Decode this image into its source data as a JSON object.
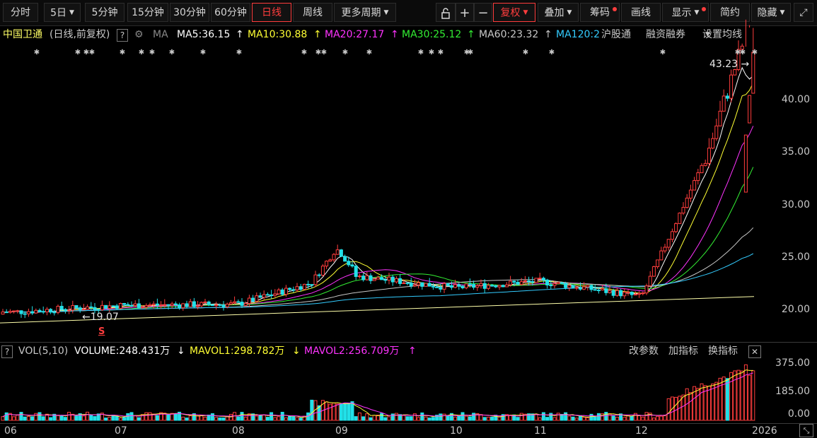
{
  "toolbar": {
    "items": [
      {
        "label": "分时"
      },
      {
        "label": "5日"
      },
      {
        "label": "5分钟"
      },
      {
        "label": "15分钟"
      },
      {
        "label": "30分钟"
      },
      {
        "label": "60分钟"
      },
      {
        "label": "日线"
      },
      {
        "label": "周线"
      },
      {
        "label": "更多周期"
      }
    ],
    "right_items": [
      {
        "label": "复权"
      },
      {
        "label": "叠加"
      },
      {
        "label": "筹码"
      },
      {
        "label": "画线"
      },
      {
        "label": "显示"
      },
      {
        "label": "简约"
      },
      {
        "label": "隐藏"
      }
    ],
    "plus": "+",
    "minus": "−",
    "expand": "⤢"
  },
  "stock": {
    "name": "中国卫通",
    "mode": "(日线,前复权)",
    "help": "?",
    "ma_title": "MA"
  },
  "ma_lines": [
    {
      "label": "MA5:36.15",
      "arrow": "↑",
      "color": "#ffffff"
    },
    {
      "label": "MA10:30.88",
      "arrow": "↑",
      "color": "#ffff33"
    },
    {
      "label": "MA20:27.17",
      "arrow": "↑",
      "color": "#ff33ff"
    },
    {
      "label": "MA30:25.12",
      "arrow": "↑",
      "color": "#33ee33"
    },
    {
      "label": "MA60:23.32",
      "arrow": "↑",
      "color": "#c8c8c8"
    },
    {
      "label": "MA120:2",
      "arrow": "",
      "color": "#33ccff"
    }
  ],
  "links": {
    "hgt": "沪股通",
    "rzrq": "融资融券",
    "setting": "设置均线"
  },
  "price_axis": {
    "labels": [
      "40.00",
      "35.00",
      "30.00",
      "25.00",
      "20.00"
    ]
  },
  "annotations": {
    "high": "43.23",
    "low": "19.07",
    "signal": "S"
  },
  "volume": {
    "title": "VOL(5,10)",
    "volume": "VOLUME:248.431万",
    "volume_arrow": "↓",
    "mavol1": "MAVOL1:298.782万",
    "mavol1_arrow": "↓",
    "mavol2": "MAVOL2:256.709万",
    "mavol2_arrow": "↑",
    "actions": [
      "改参数",
      "加指标",
      "换指标"
    ],
    "axis_labels": [
      "375.00",
      "185.00",
      "0.00"
    ]
  },
  "x_axis": {
    "labels": [
      "06",
      "07",
      "08",
      "09",
      "10",
      "11",
      "12",
      "2026"
    ]
  },
  "colors": {
    "up": "#ff3d3d",
    "down": "#22e0e8",
    "bg": "#000000"
  },
  "chart_data": {
    "type": "candlestick",
    "price_range": [
      17,
      44
    ],
    "volume_range": [
      0,
      400
    ],
    "key_points": [
      {
        "x": "06",
        "close": 19.6
      },
      {
        "x": "07",
        "close": 20.2
      },
      {
        "x": "08",
        "close": 20.3
      },
      {
        "x": "09",
        "close": 23.0
      },
      {
        "x": "10",
        "close": 21.8
      },
      {
        "x": "11",
        "close": 22.4
      },
      {
        "x": "12",
        "close": 21.0
      },
      {
        "x": "2026",
        "close": 43.23
      }
    ]
  }
}
